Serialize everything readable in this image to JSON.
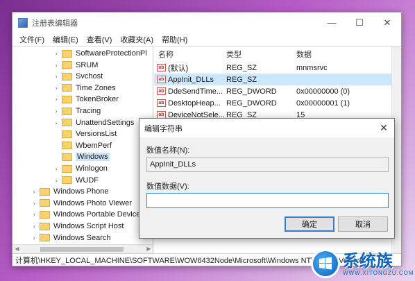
{
  "window": {
    "title": "注册表编辑器",
    "controls": {
      "minimize": "—",
      "maximize": "☐",
      "close": "✕"
    }
  },
  "menu": [
    "文件(F)",
    "编辑(E)",
    "查看(V)",
    "收藏夹(A)",
    "帮助(H)"
  ],
  "tree": {
    "items": [
      {
        "label": "SoftwareProtectionPl",
        "expander": "›",
        "folder": true,
        "selected": false
      },
      {
        "label": "SRUM",
        "expander": "›",
        "folder": true,
        "selected": false
      },
      {
        "label": "Svchost",
        "expander": "›",
        "folder": true,
        "selected": false
      },
      {
        "label": "Time Zones",
        "expander": "›",
        "folder": true,
        "selected": false
      },
      {
        "label": "TokenBroker",
        "expander": "›",
        "folder": true,
        "selected": false
      },
      {
        "label": "Tracing",
        "expander": "›",
        "folder": true,
        "selected": false
      },
      {
        "label": "UnattendSettings",
        "expander": "›",
        "folder": true,
        "selected": false
      },
      {
        "label": "VersionsList",
        "expander": "",
        "folder": true,
        "selected": false
      },
      {
        "label": "WbemPerf",
        "expander": "",
        "folder": true,
        "selected": false
      },
      {
        "label": "Windows",
        "expander": "",
        "folder": true,
        "selected": true
      },
      {
        "label": "Winlogon",
        "expander": "›",
        "folder": true,
        "selected": false
      },
      {
        "label": "WUDF",
        "expander": "›",
        "folder": true,
        "selected": false
      },
      {
        "label": "Windows Phone",
        "expander": "›",
        "folder": true,
        "selected": false
      },
      {
        "label": "Windows Photo Viewer",
        "expander": "›",
        "folder": true,
        "selected": false
      },
      {
        "label": "Windows Portable Devices",
        "expander": "›",
        "folder": true,
        "selected": false
      },
      {
        "label": "Windows Script Host",
        "expander": "›",
        "folder": true,
        "selected": false
      },
      {
        "label": "Windows Search",
        "expander": "›",
        "folder": true,
        "selected": false
      }
    ]
  },
  "list": {
    "headers": {
      "name": "名称",
      "type": "类型",
      "data": "数据"
    },
    "rows": [
      {
        "name": "(默认)",
        "type": "REG_SZ",
        "data": "mnmsrvc",
        "selected": false
      },
      {
        "name": "AppInit_DLLs",
        "type": "REG_SZ",
        "data": "",
        "selected": true
      },
      {
        "name": "DdeSendTime...",
        "type": "REG_DWORD",
        "data": "0x00000000 (0)",
        "selected": false
      },
      {
        "name": "DesktopHeap...",
        "type": "REG_DWORD",
        "data": "0x00000001 (1)",
        "selected": false
      },
      {
        "name": "DeviceNotSele...",
        "type": "REG_SZ",
        "data": "15",
        "selected": false
      }
    ]
  },
  "statusbar": {
    "path": "计算机\\HKEY_LOCAL_MACHINE\\SOFTWARE\\WOW6432Node\\Microsoft\\Windows NT\\CurrentVersion"
  },
  "dialog": {
    "title": "编辑字符串",
    "close": "✕",
    "name_label": "数值名称(N):",
    "name_value": "AppInit_DLLs",
    "data_label": "数值数据(V):",
    "data_value": "",
    "ok": "确定",
    "cancel": "取消"
  },
  "watermark": {
    "title": "系统族",
    "subtitle": "WWW.XITONGZU.COM"
  },
  "colors": {
    "selection": "#cce8ff",
    "tree_selection": "#cce4f7",
    "folder": "#f7d36b",
    "accent": "#2f7fd3"
  }
}
